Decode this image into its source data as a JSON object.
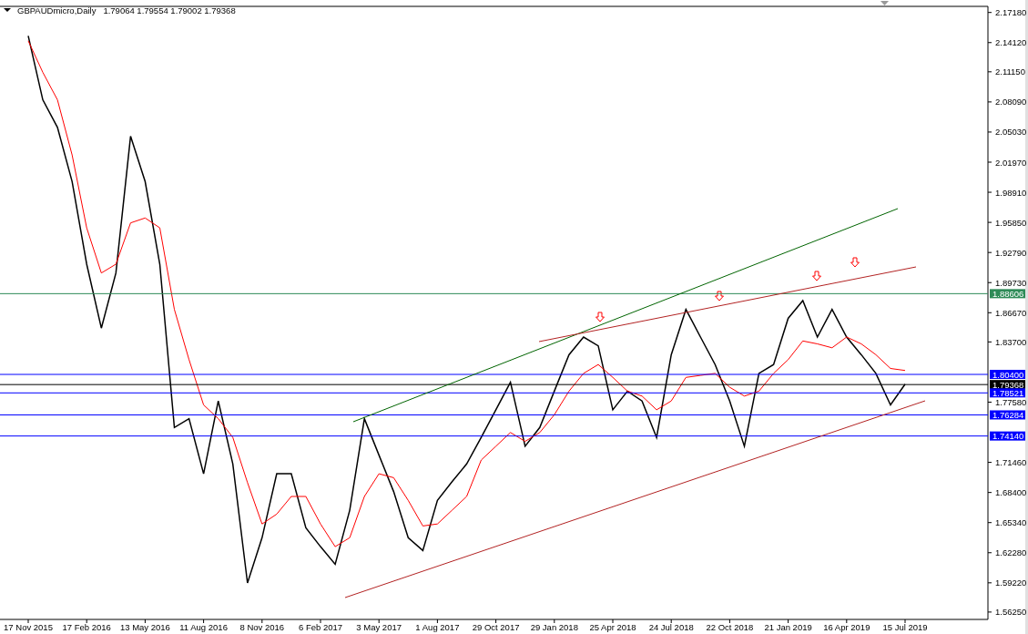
{
  "header": {
    "symbol": "GBPAUDmicro,Daily",
    "ohlc": "1.79064 1.79554 1.79002 1.79368"
  },
  "chart_data": {
    "type": "line",
    "categories": [
      "17 Nov 2015",
      null,
      null,
      null,
      "17 Feb 2016",
      null,
      null,
      null,
      "13 May 2016",
      null,
      null,
      null,
      "11 Aug 2016",
      null,
      null,
      null,
      "8 Nov 2016",
      null,
      null,
      null,
      "6 Feb 2017",
      null,
      null,
      null,
      "3 May 2017",
      null,
      null,
      null,
      "1 Aug 2017",
      null,
      null,
      null,
      "29 Oct 2017",
      null,
      null,
      null,
      "29 Jan 2018",
      null,
      null,
      null,
      "25 Apr 2018",
      null,
      null,
      null,
      "24 Jul 2018",
      null,
      null,
      null,
      "22 Oct 2018",
      null,
      null,
      null,
      "21 Jan 2019",
      null,
      null,
      null,
      "16 Apr 2019",
      null,
      null,
      null,
      "15 Jul 2019"
    ],
    "series": [
      {
        "color": "#000000",
        "values": [
          2.148,
          2.083,
          2.055,
          2.0,
          1.916,
          1.851,
          1.907,
          2.046,
          2.0,
          1.916,
          1.75,
          1.759,
          1.703,
          1.777,
          1.713,
          1.592,
          1.638,
          1.703,
          1.703,
          1.648,
          1.629,
          1.611,
          1.666,
          1.759,
          1.722,
          1.685,
          1.638,
          1.625,
          1.676,
          1.695,
          1.713,
          1.74,
          1.768,
          1.796,
          1.731,
          1.75,
          1.787,
          1.824,
          1.842,
          1.833,
          1.768,
          1.787,
          1.777,
          1.74,
          1.824,
          1.87,
          1.842,
          1.814,
          1.777,
          1.731,
          1.805,
          1.814,
          1.861,
          1.879,
          1.842,
          1.87,
          1.842,
          1.824,
          1.805,
          1.773,
          1.794
        ]
      },
      {
        "color": "#ff0000",
        "values": [
          2.143,
          2.111,
          2.083,
          2.027,
          1.953,
          1.907,
          1.916,
          1.958,
          1.963,
          1.953,
          1.87,
          1.819,
          1.773,
          1.759,
          1.74,
          1.694,
          1.652,
          1.662,
          1.68,
          1.68,
          1.652,
          1.629,
          1.638,
          1.68,
          1.703,
          1.699,
          1.676,
          1.65,
          1.652,
          1.666,
          1.68,
          1.717,
          1.731,
          1.745,
          1.736,
          1.745,
          1.763,
          1.787,
          1.805,
          1.814,
          1.801,
          1.787,
          1.782,
          1.768,
          1.777,
          1.801,
          1.803,
          1.805,
          1.791,
          1.782,
          1.787,
          1.805,
          1.819,
          1.838,
          1.835,
          1.831,
          1.842,
          1.835,
          1.824,
          1.81,
          1.808
        ]
      }
    ],
    "ylim": [
      1.555,
      2.178
    ],
    "yticks": [
      {
        "value": 2.1718,
        "label": "2.17180"
      },
      {
        "value": 2.1412,
        "label": "2.14120"
      },
      {
        "value": 2.1115,
        "label": "2.11150"
      },
      {
        "value": 2.0809,
        "label": "2.08090"
      },
      {
        "value": 2.0503,
        "label": "2.05030"
      },
      {
        "value": 2.0197,
        "label": "2.01970"
      },
      {
        "value": 1.9891,
        "label": "1.98910"
      },
      {
        "value": 1.9585,
        "label": "1.95850"
      },
      {
        "value": 1.9279,
        "label": "1.92790"
      },
      {
        "value": 1.8973,
        "label": "1.89730"
      },
      {
        "value": 1.8667,
        "label": "1.86670"
      },
      {
        "value": 1.837,
        "label": "1.83700"
      },
      {
        "value": 1.7758,
        "label": "1.77580"
      },
      {
        "value": 1.7146,
        "label": "1.71460"
      },
      {
        "value": 1.684,
        "label": "1.68400"
      },
      {
        "value": 1.6534,
        "label": "1.65340"
      },
      {
        "value": 1.6228,
        "label": "1.62280"
      },
      {
        "value": 1.5922,
        "label": "1.59220"
      },
      {
        "value": 1.5625,
        "label": "1.56250"
      }
    ]
  },
  "price_levels": [
    {
      "label": "1.88606",
      "color": "#2e8b57"
    },
    {
      "label": "1.80400",
      "color": "#0000ff"
    },
    {
      "label": "1.79368",
      "color": "#000000"
    },
    {
      "label": "1.78521",
      "color": "#0000ff"
    },
    {
      "label": "1.76284",
      "color": "#0000ff"
    },
    {
      "label": "1.74140",
      "color": "#0000ff"
    }
  ]
}
